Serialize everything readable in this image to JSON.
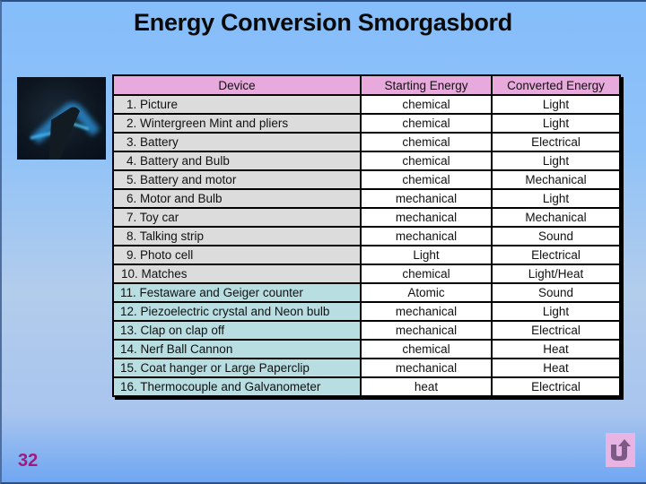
{
  "slide": {
    "title": "Energy Conversion Smorgasbord",
    "page_number": "32",
    "colors": {
      "header_fill": "#e8a9dc",
      "device_fill_a": "#dcdcdc",
      "device_fill_b": "#b8dee2",
      "page_number": "#a3177f",
      "return_button_fill": "#e8b4e4",
      "return_icon": "#7b5a85"
    },
    "image": {
      "semantic": "glowing-object-dark-photo"
    },
    "return_button": {
      "icon": "u-turn-arrow-icon"
    }
  },
  "table": {
    "headers": [
      "Device",
      "Starting Energy",
      "Converted Energy"
    ],
    "rows": [
      {
        "device": "1. Picture",
        "start": "chemical",
        "converted": "Light"
      },
      {
        "device": "2. Wintergreen Mint and pliers",
        "start": "chemical",
        "converted": "Light"
      },
      {
        "device": "3. Battery",
        "start": "chemical",
        "converted": "Electrical"
      },
      {
        "device": "4. Battery and Bulb",
        "start": "chemical",
        "converted": "Light"
      },
      {
        "device": "5. Battery and motor",
        "start": "chemical",
        "converted": "Mechanical"
      },
      {
        "device": "6. Motor and Bulb",
        "start": "mechanical",
        "converted": "Light"
      },
      {
        "device": "7. Toy car",
        "start": "mechanical",
        "converted": "Mechanical"
      },
      {
        "device": "8. Talking strip",
        "start": "mechanical",
        "converted": "Sound"
      },
      {
        "device": "9. Photo cell",
        "start": "Light",
        "converted": "Electrical"
      },
      {
        "device": "10. Matches",
        "start": "chemical",
        "converted": "Light/Heat"
      },
      {
        "device": "11. Festaware and Geiger counter",
        "start": "Atomic",
        "converted": "Sound"
      },
      {
        "device": "12. Piezoelectric crystal and Neon bulb",
        "start": "mechanical",
        "converted": "Light"
      },
      {
        "device": "13. Clap on clap off",
        "start": "mechanical",
        "converted": "Electrical"
      },
      {
        "device": "14. Nerf Ball Cannon",
        "start": "chemical",
        "converted": "Heat"
      },
      {
        "device": "15. Coat hanger or Large Paperclip",
        "start": "mechanical",
        "converted": "Heat"
      },
      {
        "device": "16. Thermocouple and Galvanometer",
        "start": "heat",
        "converted": "Electrical"
      }
    ]
  }
}
